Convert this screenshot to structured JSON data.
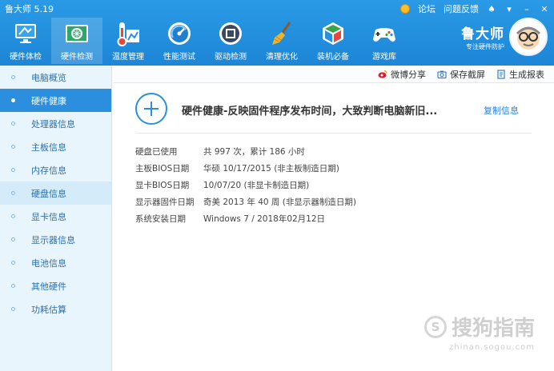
{
  "window": {
    "title": "鲁大师 5.19",
    "links": [
      "论坛",
      "问题反馈"
    ]
  },
  "toolbar": [
    {
      "label": "硬件体检",
      "icon": "monitor-icon"
    },
    {
      "label": "硬件检测",
      "icon": "circuit-board-icon"
    },
    {
      "label": "温度管理",
      "icon": "thermometer-icon"
    },
    {
      "label": "性能测试",
      "icon": "speedometer-icon"
    },
    {
      "label": "驱动检测",
      "icon": "driver-chip-icon"
    },
    {
      "label": "清理优化",
      "icon": "broom-icon"
    },
    {
      "label": "装机必备",
      "icon": "cube-box-icon"
    },
    {
      "label": "游戏库",
      "icon": "gamepad-icon"
    }
  ],
  "brand": {
    "name": "鲁大师",
    "slogan": "专注硬件防护"
  },
  "sidebar": [
    {
      "label": "电脑概览"
    },
    {
      "label": "硬件健康"
    },
    {
      "label": "处理器信息"
    },
    {
      "label": "主板信息"
    },
    {
      "label": "内存信息"
    },
    {
      "label": "硬盘信息"
    },
    {
      "label": "显卡信息"
    },
    {
      "label": "显示器信息"
    },
    {
      "label": "电池信息"
    },
    {
      "label": "其他硬件"
    },
    {
      "label": "功耗估算"
    }
  ],
  "subbar": {
    "weibo": "微博分享",
    "screenshot": "保存截屏",
    "report": "生成报表"
  },
  "main": {
    "heading": "硬件健康-反映固件程序发布时间，大致判断电脑新旧...",
    "copy_label": "复制信息",
    "rows": [
      {
        "k": "硬盘已使用",
        "v": "共 997 次，累计 186 小时"
      },
      {
        "k": "主板BIOS日期",
        "v": "华硕 10/17/2015 (非主板制造日期)"
      },
      {
        "k": "显卡BIOS日期",
        "v": "10/07/20 (非显卡制造日期)"
      },
      {
        "k": "显示器固件日期",
        "v": "奇美 2013 年 40 周 (非显示器制造日期)"
      },
      {
        "k": "系统安装日期",
        "v": "Windows 7 / 2018年02月12日"
      }
    ]
  },
  "watermark": {
    "text": "搜狗指南",
    "url": "zhinan.sogou.com"
  }
}
